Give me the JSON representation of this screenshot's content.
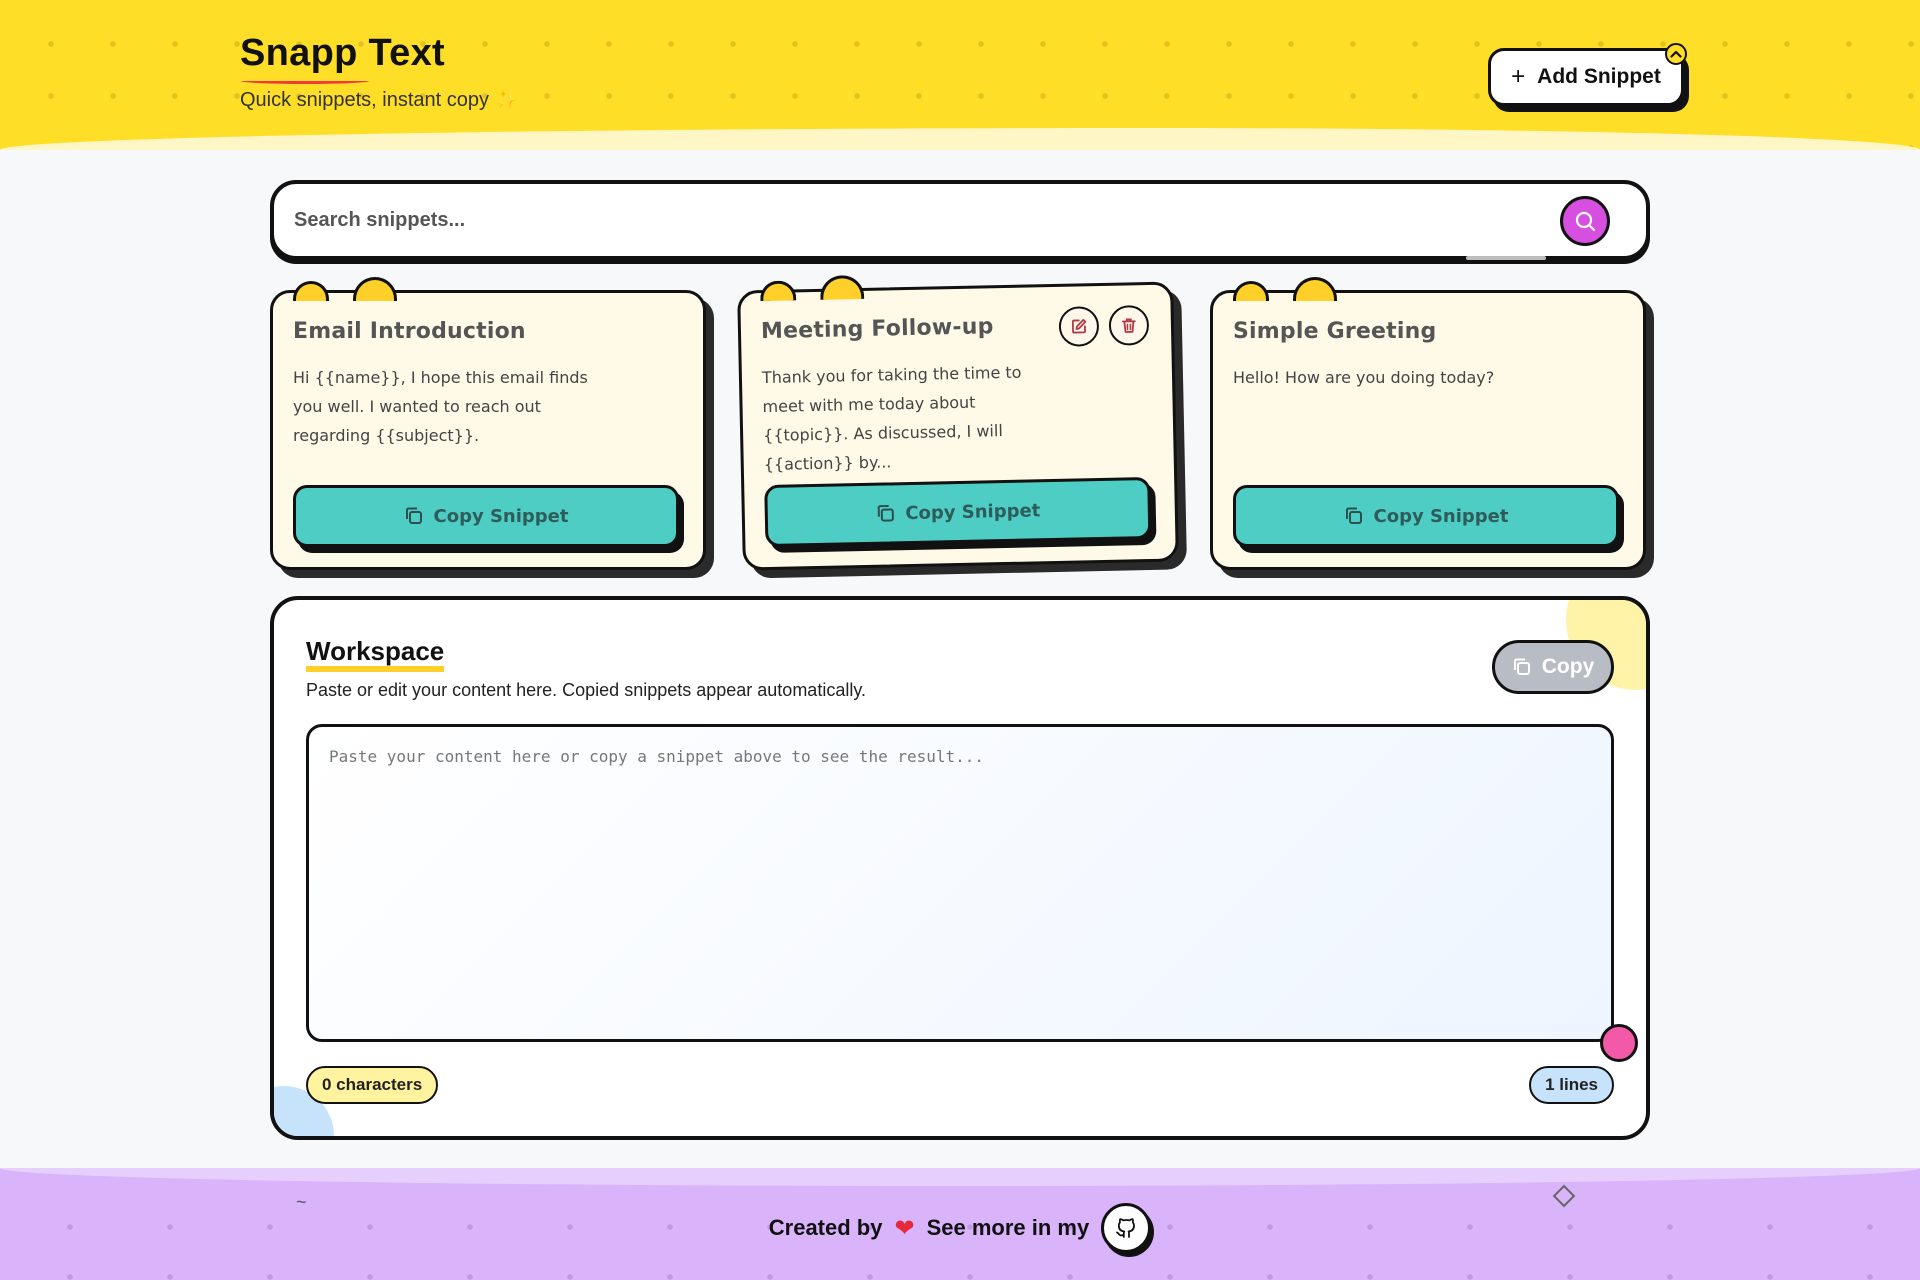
{
  "header": {
    "title": "Snapp Text",
    "tagline": "Quick snippets, instant copy",
    "sparkle": "✨",
    "add_button_label": "Add Snippet",
    "add_button_icon": "plus-icon"
  },
  "search": {
    "placeholder": "Search snippets...",
    "value": "",
    "icon": "search-icon",
    "button_color": "#d64fe0"
  },
  "snippets": [
    {
      "title": "Email Introduction",
      "body": "Hi {{name}}, I hope this email finds you well. I wanted to reach out regarding {{subject}}.",
      "copy_label": "Copy Snippet",
      "show_actions": false
    },
    {
      "title": "Meeting Follow-up",
      "body": "Thank you for taking the time to meet with me today about {{topic}}. As discussed, I will {{action}} by...",
      "copy_label": "Copy Snippet",
      "show_actions": true
    },
    {
      "title": "Simple Greeting",
      "body": "Hello! How are you doing today?",
      "copy_label": "Copy Snippet",
      "show_actions": false
    }
  ],
  "workspace": {
    "title": "Workspace",
    "subtitle": "Paste or edit your content here. Copied snippets appear automatically.",
    "copy_label": "Copy",
    "textarea_placeholder": "Paste your content here or copy a snippet above to see the result...",
    "textarea_value": "",
    "characters_label": "0 characters",
    "lines_label": "1 lines"
  },
  "footer": {
    "created_by": "Created by",
    "heart": "❤",
    "see_more": "See more in my",
    "github_icon": "github-icon"
  },
  "colors": {
    "header_bg": "#ffde27",
    "accent_teal": "#4ecdc4",
    "accent_pink": "#f25aa8",
    "footer_bg": "#d9b4fb",
    "card_bg": "#fff9e8"
  }
}
